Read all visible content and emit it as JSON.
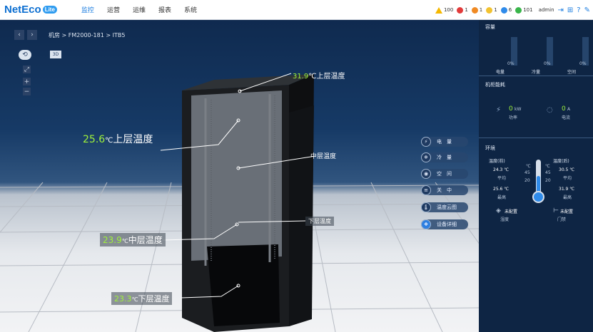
{
  "app": {
    "logo": "NetEco",
    "logo_badge": "Lite"
  },
  "nav": [
    {
      "label": "监控",
      "active": true
    },
    {
      "label": "运营",
      "active": false
    },
    {
      "label": "运维",
      "active": false
    },
    {
      "label": "报表",
      "active": false
    },
    {
      "label": "系统",
      "active": false
    }
  ],
  "alarms": [
    {
      "kind": "warning",
      "count": "100",
      "color": "#f5b800"
    },
    {
      "kind": "critical",
      "count": "1",
      "color": "#e23b3b"
    },
    {
      "kind": "major",
      "count": "1",
      "color": "#f08a24"
    },
    {
      "kind": "minor",
      "count": "1",
      "color": "#f2c230"
    },
    {
      "kind": "info",
      "count": "6",
      "color": "#2f8bea"
    },
    {
      "kind": "ok",
      "count": "101",
      "color": "#39b54a"
    }
  ],
  "user": {
    "name": "admin"
  },
  "scene": {
    "breadcrumb": "机房 > FM2000-181 > ITB5",
    "view_3d": "3D",
    "labels": {
      "top_right": {
        "value": "31.9",
        "unit": "℃",
        "name": "上层温度"
      },
      "top_left": {
        "value": "25.6",
        "unit": "℃",
        "name": "上层温度"
      },
      "mid_right": {
        "name": "中层温度"
      },
      "mid_left": {
        "value": "23.9",
        "unit": "℃",
        "name": "中层温度"
      },
      "low_right": {
        "name": "下层温度"
      },
      "low_left": {
        "value": "23.3",
        "unit": "℃",
        "name": "下层温度"
      }
    },
    "side_buttons": [
      {
        "icon": "⚡",
        "label": "电　量"
      },
      {
        "icon": "❄",
        "label": "冷　量"
      },
      {
        "icon": "◉",
        "label": "空　间"
      },
      {
        "icon": "≡",
        "label": "关　中"
      },
      {
        "icon": "🌡",
        "label": "温度云图"
      },
      {
        "icon": "❖",
        "label": "设备详细"
      }
    ]
  },
  "panel": {
    "capacity_title": "容量",
    "capacity": [
      {
        "label": "电量",
        "pct": "0%"
      },
      {
        "label": "冷量",
        "pct": "0%"
      },
      {
        "label": "空间",
        "pct": "0%"
      }
    ],
    "power_title": "机柜能耗",
    "power": {
      "value": "0",
      "unit": "kW",
      "label": "功率"
    },
    "current": {
      "value": "0",
      "unit": "A",
      "label": "电流"
    },
    "env_title": "环境",
    "front_title": "温度(前)",
    "back_title": "温度(后)",
    "front": {
      "avg": "24.3 ℃",
      "avg_label": "平均",
      "max": "25.6 ℃",
      "max_label": "最高"
    },
    "back": {
      "avg": "30.5 ℃",
      "avg_label": "平均",
      "max": "31.9 ℃",
      "max_label": "最高"
    },
    "scale": {
      "top": "45",
      "mid": "20",
      "unit": "℃"
    },
    "thermo_level": 0.55,
    "humidity": {
      "value": "未配置",
      "label": "湿度"
    },
    "door": {
      "value": "未配置",
      "label": "门禁"
    }
  }
}
